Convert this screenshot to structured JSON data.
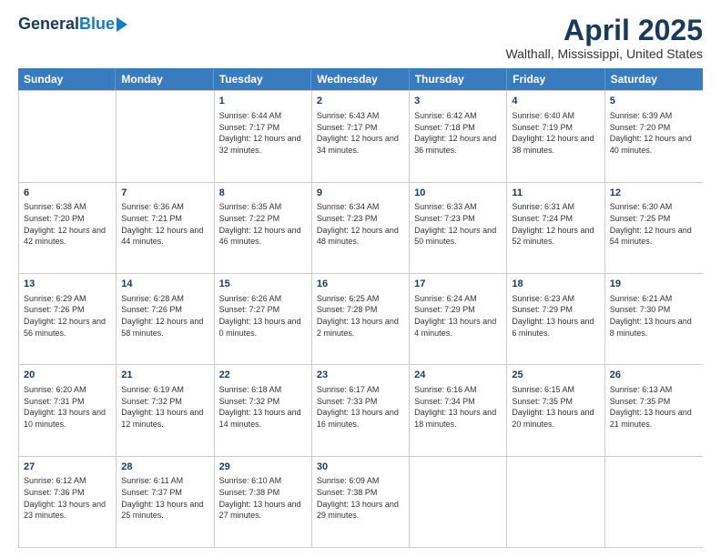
{
  "header": {
    "logo_general": "General",
    "logo_blue": "Blue",
    "month": "April 2025",
    "location": "Walthall, Mississippi, United States"
  },
  "days_of_week": [
    "Sunday",
    "Monday",
    "Tuesday",
    "Wednesday",
    "Thursday",
    "Friday",
    "Saturday"
  ],
  "rows": [
    [
      {
        "day": "",
        "sunrise": "",
        "sunset": "",
        "daylight": ""
      },
      {
        "day": "",
        "sunrise": "",
        "sunset": "",
        "daylight": ""
      },
      {
        "day": "1",
        "sunrise": "Sunrise: 6:44 AM",
        "sunset": "Sunset: 7:17 PM",
        "daylight": "Daylight: 12 hours and 32 minutes."
      },
      {
        "day": "2",
        "sunrise": "Sunrise: 6:43 AM",
        "sunset": "Sunset: 7:17 PM",
        "daylight": "Daylight: 12 hours and 34 minutes."
      },
      {
        "day": "3",
        "sunrise": "Sunrise: 6:42 AM",
        "sunset": "Sunset: 7:18 PM",
        "daylight": "Daylight: 12 hours and 36 minutes."
      },
      {
        "day": "4",
        "sunrise": "Sunrise: 6:40 AM",
        "sunset": "Sunset: 7:19 PM",
        "daylight": "Daylight: 12 hours and 38 minutes."
      },
      {
        "day": "5",
        "sunrise": "Sunrise: 6:39 AM",
        "sunset": "Sunset: 7:20 PM",
        "daylight": "Daylight: 12 hours and 40 minutes."
      }
    ],
    [
      {
        "day": "6",
        "sunrise": "Sunrise: 6:38 AM",
        "sunset": "Sunset: 7:20 PM",
        "daylight": "Daylight: 12 hours and 42 minutes."
      },
      {
        "day": "7",
        "sunrise": "Sunrise: 6:36 AM",
        "sunset": "Sunset: 7:21 PM",
        "daylight": "Daylight: 12 hours and 44 minutes."
      },
      {
        "day": "8",
        "sunrise": "Sunrise: 6:35 AM",
        "sunset": "Sunset: 7:22 PM",
        "daylight": "Daylight: 12 hours and 46 minutes."
      },
      {
        "day": "9",
        "sunrise": "Sunrise: 6:34 AM",
        "sunset": "Sunset: 7:23 PM",
        "daylight": "Daylight: 12 hours and 48 minutes."
      },
      {
        "day": "10",
        "sunrise": "Sunrise: 6:33 AM",
        "sunset": "Sunset: 7:23 PM",
        "daylight": "Daylight: 12 hours and 50 minutes."
      },
      {
        "day": "11",
        "sunrise": "Sunrise: 6:31 AM",
        "sunset": "Sunset: 7:24 PM",
        "daylight": "Daylight: 12 hours and 52 minutes."
      },
      {
        "day": "12",
        "sunrise": "Sunrise: 6:30 AM",
        "sunset": "Sunset: 7:25 PM",
        "daylight": "Daylight: 12 hours and 54 minutes."
      }
    ],
    [
      {
        "day": "13",
        "sunrise": "Sunrise: 6:29 AM",
        "sunset": "Sunset: 7:26 PM",
        "daylight": "Daylight: 12 hours and 56 minutes."
      },
      {
        "day": "14",
        "sunrise": "Sunrise: 6:28 AM",
        "sunset": "Sunset: 7:26 PM",
        "daylight": "Daylight: 12 hours and 58 minutes."
      },
      {
        "day": "15",
        "sunrise": "Sunrise: 6:26 AM",
        "sunset": "Sunset: 7:27 PM",
        "daylight": "Daylight: 13 hours and 0 minutes."
      },
      {
        "day": "16",
        "sunrise": "Sunrise: 6:25 AM",
        "sunset": "Sunset: 7:28 PM",
        "daylight": "Daylight: 13 hours and 2 minutes."
      },
      {
        "day": "17",
        "sunrise": "Sunrise: 6:24 AM",
        "sunset": "Sunset: 7:29 PM",
        "daylight": "Daylight: 13 hours and 4 minutes."
      },
      {
        "day": "18",
        "sunrise": "Sunrise: 6:23 AM",
        "sunset": "Sunset: 7:29 PM",
        "daylight": "Daylight: 13 hours and 6 minutes."
      },
      {
        "day": "19",
        "sunrise": "Sunrise: 6:21 AM",
        "sunset": "Sunset: 7:30 PM",
        "daylight": "Daylight: 13 hours and 8 minutes."
      }
    ],
    [
      {
        "day": "20",
        "sunrise": "Sunrise: 6:20 AM",
        "sunset": "Sunset: 7:31 PM",
        "daylight": "Daylight: 13 hours and 10 minutes."
      },
      {
        "day": "21",
        "sunrise": "Sunrise: 6:19 AM",
        "sunset": "Sunset: 7:32 PM",
        "daylight": "Daylight: 13 hours and 12 minutes."
      },
      {
        "day": "22",
        "sunrise": "Sunrise: 6:18 AM",
        "sunset": "Sunset: 7:32 PM",
        "daylight": "Daylight: 13 hours and 14 minutes."
      },
      {
        "day": "23",
        "sunrise": "Sunrise: 6:17 AM",
        "sunset": "Sunset: 7:33 PM",
        "daylight": "Daylight: 13 hours and 16 minutes."
      },
      {
        "day": "24",
        "sunrise": "Sunrise: 6:16 AM",
        "sunset": "Sunset: 7:34 PM",
        "daylight": "Daylight: 13 hours and 18 minutes."
      },
      {
        "day": "25",
        "sunrise": "Sunrise: 6:15 AM",
        "sunset": "Sunset: 7:35 PM",
        "daylight": "Daylight: 13 hours and 20 minutes."
      },
      {
        "day": "26",
        "sunrise": "Sunrise: 6:13 AM",
        "sunset": "Sunset: 7:35 PM",
        "daylight": "Daylight: 13 hours and 21 minutes."
      }
    ],
    [
      {
        "day": "27",
        "sunrise": "Sunrise: 6:12 AM",
        "sunset": "Sunset: 7:36 PM",
        "daylight": "Daylight: 13 hours and 23 minutes."
      },
      {
        "day": "28",
        "sunrise": "Sunrise: 6:11 AM",
        "sunset": "Sunset: 7:37 PM",
        "daylight": "Daylight: 13 hours and 25 minutes."
      },
      {
        "day": "29",
        "sunrise": "Sunrise: 6:10 AM",
        "sunset": "Sunset: 7:38 PM",
        "daylight": "Daylight: 13 hours and 27 minutes."
      },
      {
        "day": "30",
        "sunrise": "Sunrise: 6:09 AM",
        "sunset": "Sunset: 7:38 PM",
        "daylight": "Daylight: 13 hours and 29 minutes."
      },
      {
        "day": "",
        "sunrise": "",
        "sunset": "",
        "daylight": ""
      },
      {
        "day": "",
        "sunrise": "",
        "sunset": "",
        "daylight": ""
      },
      {
        "day": "",
        "sunrise": "",
        "sunset": "",
        "daylight": ""
      }
    ]
  ]
}
